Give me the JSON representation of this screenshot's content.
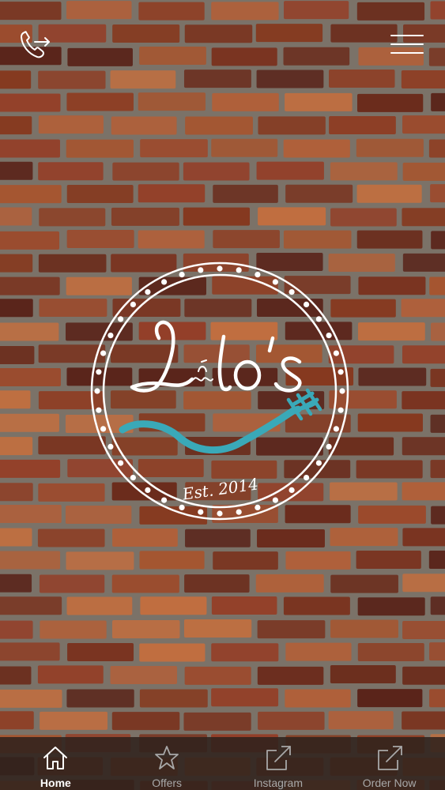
{
  "app": {
    "brand_name": "Lilo's",
    "established": "Est. 2014"
  },
  "header": {
    "call_icon": "phone-outgoing-icon",
    "menu_icon": "hamburger-menu-icon"
  },
  "colors": {
    "tab_active": "#ffffff",
    "tab_inactive": "#a8a8a8",
    "logo_accent": "#3aa9b8",
    "logo_line": "#ffffff"
  },
  "tabs": [
    {
      "label": "Home",
      "icon": "house-icon",
      "active": true
    },
    {
      "label": "Offers",
      "icon": "star-icon",
      "active": false
    },
    {
      "label": "Instagram",
      "icon": "external-link-icon",
      "active": false
    },
    {
      "label": "Order Now",
      "icon": "external-link-icon",
      "active": false
    }
  ]
}
